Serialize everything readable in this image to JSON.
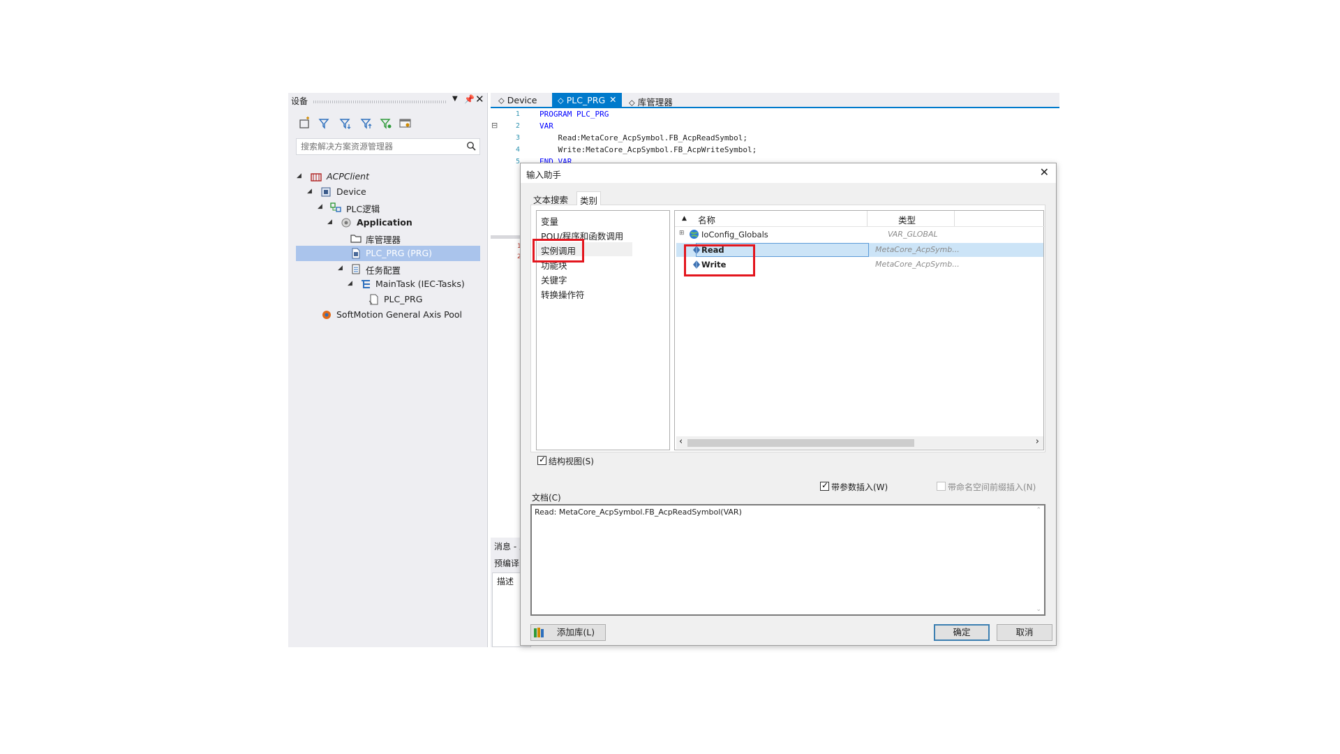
{
  "device_panel": {
    "title": "设备",
    "search_placeholder": "搜索解决方案资源管理器",
    "tree": [
      {
        "label": "ACPClient",
        "italic": true
      },
      {
        "label": "Device"
      },
      {
        "label": "PLC逻辑"
      },
      {
        "label": "Application",
        "bold": true
      },
      {
        "label": "库管理器"
      },
      {
        "label": "PLC_PRG (PRG)",
        "selected": true
      },
      {
        "label": "任务配置"
      },
      {
        "label": "MainTask (IEC-Tasks)"
      },
      {
        "label": "PLC_PRG"
      },
      {
        "label": "SoftMotion General Axis Pool"
      }
    ]
  },
  "editor": {
    "tabs": [
      "Device",
      "PLC_PRG",
      "库管理器"
    ],
    "line_numbers": [
      "1",
      "2",
      "3",
      "4",
      "5"
    ],
    "code_lines": [
      "PROGRAM PLC_PRG",
      "VAR",
      "    Read:MetaCore_AcpSymbol.FB_AcpReadSymbol;",
      "    Write:MetaCore_AcpSymbol.FB_AcpWriteSymbol;",
      "END_VAR"
    ],
    "lower_line_numbers": [
      "1",
      "2"
    ]
  },
  "message_panel": {
    "title": "消息 - 总",
    "row1": "预编译",
    "col_header": "描述"
  },
  "dialog": {
    "title": "输入助手",
    "tabs": [
      "文本搜索",
      "类别"
    ],
    "categories": [
      "变量",
      "POU/程序和函数调用",
      "实例调用",
      "功能块",
      "关键字",
      "转换操作符"
    ],
    "columns": {
      "name": "名称",
      "type": "类型"
    },
    "rows": [
      {
        "name": "IoConfig_Globals",
        "type": "VAR_GLOBAL"
      },
      {
        "name": "Read",
        "type": "MetaCore_AcpSymb..."
      },
      {
        "name": "Write",
        "type": "MetaCore_AcpSymb..."
      }
    ],
    "structured_view_label": "结构视图(S)",
    "insert_with_args_label": "带参数插入(W)",
    "insert_with_namespace_label": "带命名空间前缀插入(N)",
    "doc_label": "文档(C)",
    "doc_text": "Read: MetaCore_AcpSymbol.FB_AcpReadSymbol(VAR)",
    "add_library_label": "添加库(L)",
    "ok_label": "确定",
    "cancel_label": "取消"
  }
}
